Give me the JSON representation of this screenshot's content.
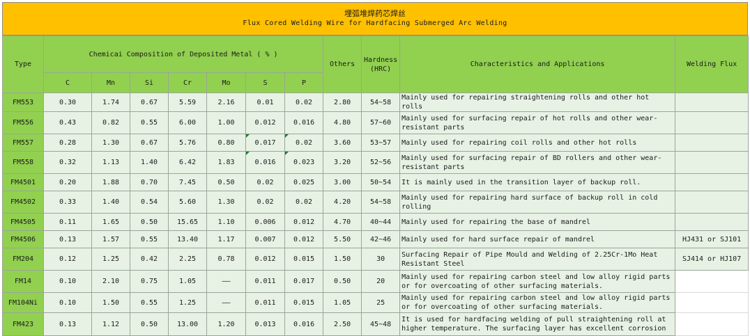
{
  "title_cn": "埋弧堆焊药芯焊丝",
  "title_en": "Flux Cored Welding Wire for Hardfacing Submerged Arc Welding",
  "headers": {
    "type": "Type",
    "composition": "Chemicai Composition of Deposited Metal ( % )",
    "elements": [
      "C",
      "Mn",
      "Si",
      "Cr",
      "Mo",
      "S",
      "P"
    ],
    "others": "Others",
    "hardness_line1": "Hardness",
    "hardness_line2": "(HRC)",
    "characteristics": "Characteristics and Applications",
    "flux": "Welding Flux"
  },
  "rows": [
    {
      "type": "FM553",
      "C": "0.30",
      "Mn": "1.74",
      "Si": "0.67",
      "Cr": "5.59",
      "Mo": "2.16",
      "S": "0.01",
      "P": "0.02",
      "others": "2.80",
      "hardness": "54~58",
      "char": "Mainly used for repairing straightening rolls and other hot rolls",
      "flux": ""
    },
    {
      "type": "FM556",
      "C": "0.43",
      "Mn": "0.82",
      "Si": "0.55",
      "Cr": "6.00",
      "Mo": "1.00",
      "S": "0.012",
      "P": "0.016",
      "others": "4.80",
      "hardness": "57~60",
      "char": "Mainly used for surfacing repair of hot rolls and other wear-resistant parts",
      "flux": ""
    },
    {
      "type": "FM557",
      "C": "0.28",
      "Mn": "1.30",
      "Si": "0.67",
      "Cr": "5.76",
      "Mo": "0.80",
      "S": "0.017",
      "P": "0.02",
      "others": "3.60",
      "hardness": "53~57",
      "char": "Mainly used for repairing coil rolls and other hot rolls",
      "flux": ""
    },
    {
      "type": "FM558",
      "C": "0.32",
      "Mn": "1.13",
      "Si": "1.40",
      "Cr": "6.42",
      "Mo": "1.83",
      "S": "0.016",
      "P": "0.023",
      "others": "3.20",
      "hardness": "52~56",
      "char": "Mainly used for surfacing repair of BD rollers and other wear-resistant parts",
      "flux": ""
    },
    {
      "type": "FM4501",
      "C": "0.20",
      "Mn": "1.88",
      "Si": "0.70",
      "Cr": "7.45",
      "Mo": "0.50",
      "S": "0.02",
      "P": "0.025",
      "others": "3.00",
      "hardness": "50~54",
      "char": "It is mainly used in the transition layer of backup roll.",
      "flux": ""
    },
    {
      "type": "FM4502",
      "C": "0.33",
      "Mn": "1.40",
      "Si": "0.54",
      "Cr": "5.60",
      "Mo": "1.30",
      "S": "0.02",
      "P": "0.02",
      "others": "4.20",
      "hardness": "54~58",
      "char": "Mainly used for repairing hard surface of backup roll in cold rolling",
      "flux": ""
    },
    {
      "type": "FM4505",
      "C": "0.11",
      "Mn": "1.65",
      "Si": "0.50",
      "Cr": "15.65",
      "Mo": "1.10",
      "S": "0.006",
      "P": "0.012",
      "others": "4.70",
      "hardness": "40~44",
      "char": "Mainly used for repairing the base of mandrel",
      "flux": ""
    },
    {
      "type": "FM4506",
      "C": "0.13",
      "Mn": "1.57",
      "Si": "0.55",
      "Cr": "13.40",
      "Mo": "1.17",
      "S": "0.007",
      "P": "0.012",
      "others": "5.50",
      "hardness": "42~46",
      "char": "Mainly used for hard surface repair of mandrel",
      "flux": "HJ431 or SJ101"
    },
    {
      "type": "FM204",
      "C": "0.12",
      "Mn": "1.25",
      "Si": "0.42",
      "Cr": "2.25",
      "Mo": "0.78",
      "S": "0.012",
      "P": "0.015",
      "others": "1.50",
      "hardness": "30",
      "char": "Surfacing Repair of Pipe Mould and Welding of 2.25Cr-1Mo Heat Resistant Steel",
      "flux": "SJ414 or HJ107"
    },
    {
      "type": "FM14",
      "C": "0.10",
      "Mn": "2.10",
      "Si": "0.75",
      "Cr": "1.05",
      "Mo": "——",
      "S": "0.011",
      "P": "0.017",
      "others": "0.50",
      "hardness": "20",
      "char": "Mainly used for repairing carbon steel and low alloy rigid parts or for overcoating of other surfacing materials.",
      "flux": ""
    },
    {
      "type": "FM104Ni",
      "C": "0.10",
      "Mn": "1.50",
      "Si": "0.55",
      "Cr": "1.25",
      "Mo": "——",
      "S": "0.011",
      "P": "0.015",
      "others": "1.05",
      "hardness": "25",
      "char": "Mainly used for repairing carbon steel and low alloy rigid parts or for overcoating of other surfacing materials.",
      "flux": ""
    },
    {
      "type": "FM423",
      "C": "0.13",
      "Mn": "1.12",
      "Si": "0.50",
      "Cr": "13.00",
      "Mo": "1.20",
      "S": "0.013",
      "P": "0.016",
      "others": "2.50",
      "hardness": "45~48",
      "char": "It is used for hardfacing welding of pull straightening roll at higher temperature. The surfacing layer has excellent corrosion",
      "flux": ""
    }
  ]
}
